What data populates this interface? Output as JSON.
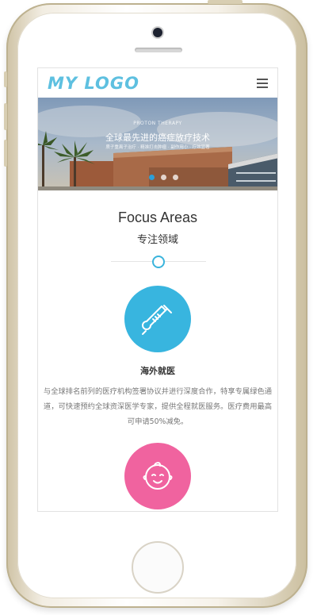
{
  "header": {
    "logo_text": "MY LOGO"
  },
  "banner": {
    "kicker": "PROTON THERAPY",
    "title": "全球最先进的癌症放疗技术",
    "subtitle": "质子重离子治疗 · 精准打击肿瘤 · 副作用小 · 疗效显著"
  },
  "focus": {
    "title": "Focus Areas",
    "subtitle": "专注领域"
  },
  "services": [
    {
      "icon": "thermometer-icon",
      "color": "#38b5df",
      "title": "海外就医",
      "description": "与全球排名前列的医疗机构签署协议并进行深度合作，特享专属绿色通道，可快速预约全球资深医学专家，提供全程就医服务。医疗费用最高可申请50%减免。"
    },
    {
      "icon": "baby-face-icon",
      "color": "#f0639f"
    }
  ],
  "colors": {
    "accent": "#38b5df",
    "pink": "#f0639f",
    "logo": "#5ec0e0"
  }
}
